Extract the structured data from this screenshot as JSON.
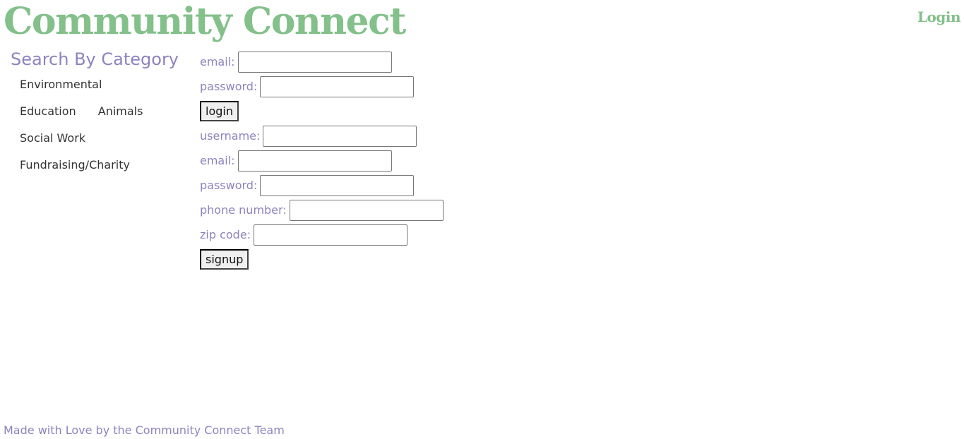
{
  "header": {
    "brand": "Community Connect",
    "login_link": "Login"
  },
  "sidebar": {
    "title": "Search By Category",
    "categories": [
      "Environmental",
      "Education",
      "Animals",
      "Social Work",
      "Fundraising/Charity"
    ]
  },
  "login_form": {
    "email_label": "email:",
    "email_value": "",
    "password_label": "password:",
    "password_value": "",
    "submit_label": "login"
  },
  "signup_form": {
    "username_label": "username:",
    "username_value": "",
    "email_label": "email:",
    "email_value": "",
    "password_label": "password:",
    "password_value": "",
    "phone_label": "phone number:",
    "phone_value": "",
    "zip_label": "zip code:",
    "zip_value": "",
    "submit_label": "signup"
  },
  "footer": {
    "text": "Made with Love by the Community Connect Team"
  },
  "colors": {
    "brand_green": "#83c08a",
    "accent_purple": "#8c84bd",
    "text_dark": "#333333",
    "background": "#ffffff"
  }
}
